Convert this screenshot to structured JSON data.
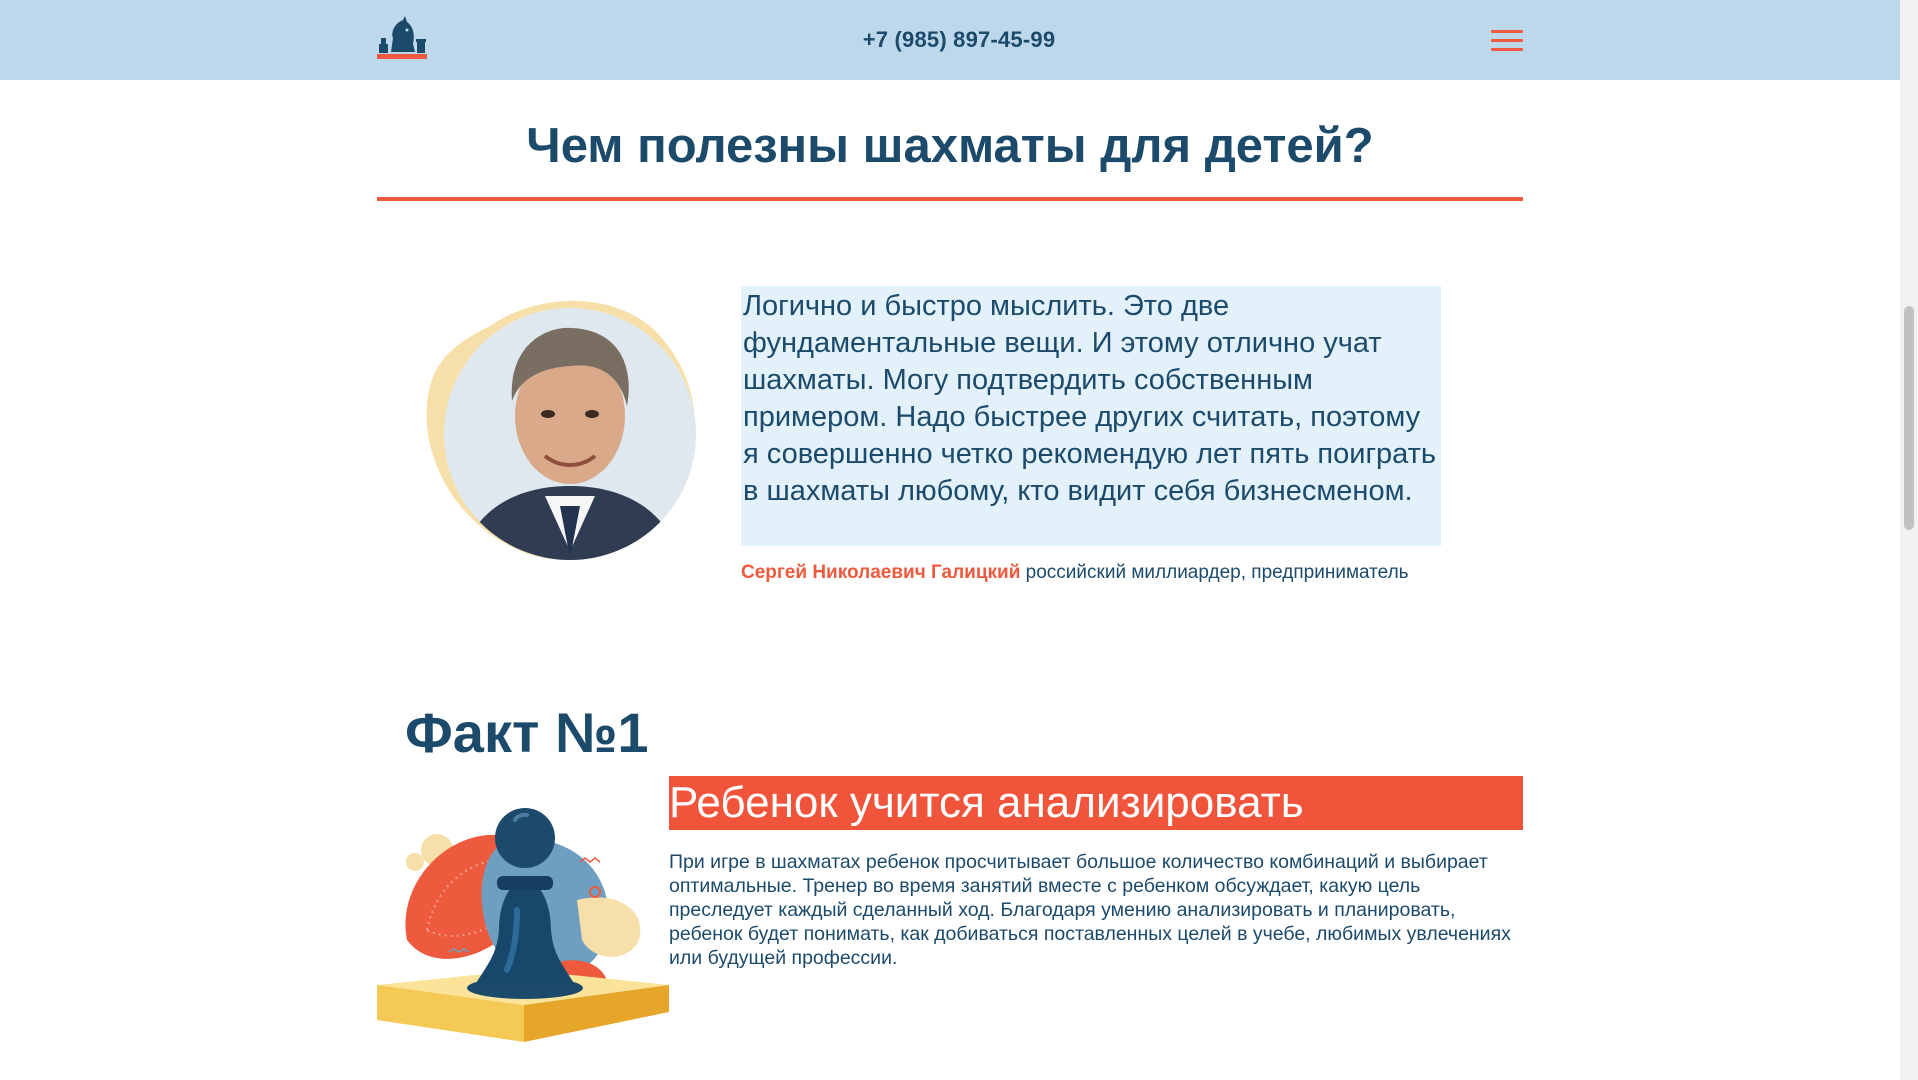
{
  "header": {
    "logo_icon": "chess-knight-logo",
    "phone": "+7 (985) 897-45-99",
    "menu_icon": "hamburger-menu-icon",
    "accent_color": "#ee5a3e",
    "background_color": "#bcd8ea"
  },
  "section": {
    "title": "Чем полезны шахматы для детей?"
  },
  "quote": {
    "text": "Логично и быстро мыслить. Это две фундаментальные вещи. И этому отлично учат шахматы. Могу подтвердить собственным примером. Надо быстрее других считать, поэтому я совершенно четко рекомендую лет пять поиграть в шахматы любому, кто видит себя бизнесменом.",
    "author_name": "Сергей Николаевич Галицкий",
    "author_role": "российский миллиардер, предприниматель"
  },
  "fact": {
    "title": "Факт №1",
    "heading": "Ребенок учится анализировать",
    "text": "При игре в шахматах ребенок просчитывает большое количество комбинаций и выбирает оптимальные. Тренер во время занятий вместе с ребенком обсуждает, какую цель преследует каждый сделанный ход. Благодаря умению анализировать и планировать, ребенок будет понимать, как добиваться поставленных целей в учебе, любимых увлечениях или будущей профессии.",
    "illustration_icon": "chess-pawn-illustration"
  }
}
